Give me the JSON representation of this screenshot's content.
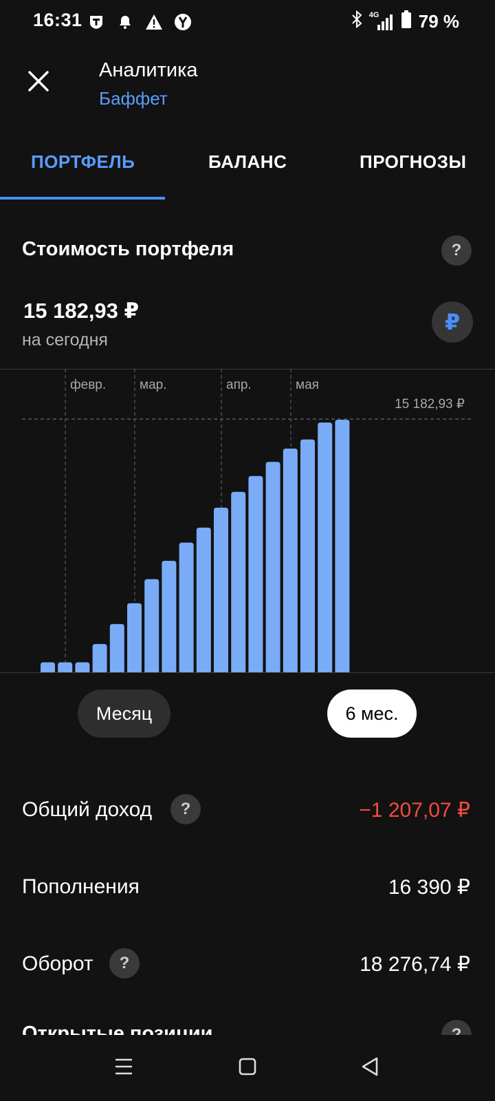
{
  "status": {
    "time": "16:31",
    "icons_left": [
      "t-app-icon",
      "bell-icon",
      "warning-icon",
      "yandex-icon"
    ],
    "network": "4G",
    "battery": "79 %"
  },
  "header": {
    "title": "Аналитика",
    "subtitle": "Баффет"
  },
  "tabs": [
    {
      "label": "ПОРТФЕЛЬ",
      "active": true,
      "color": "#5a9cff"
    },
    {
      "label": "БАЛАНС",
      "active": false
    },
    {
      "label": "ПРОГНОЗЫ",
      "active": false
    }
  ],
  "portfolio": {
    "section_title": "Стоимость портфеля",
    "help": "?",
    "value": "15 182,93 ₽",
    "value_caption": "на сегодня",
    "currency_symbol": "₽"
  },
  "chart_data": {
    "type": "bar",
    "month_labels": [
      "февр.",
      "мар.",
      "апр.",
      "мая"
    ],
    "max_label": "15 182,93 ₽",
    "ylim": [
      0,
      15182.93
    ],
    "values": [
      600,
      600,
      600,
      1700,
      2900,
      4150,
      5600,
      6700,
      7800,
      8700,
      9900,
      10850,
      11800,
      12650,
      13450,
      14000,
      15020,
      15182.93
    ],
    "bar_color": "#7aabf7"
  },
  "periods": [
    {
      "label": "Месяц",
      "selected": false
    },
    {
      "label": "6 мес.",
      "selected": true
    }
  ],
  "stats": [
    {
      "label": "Общий доход",
      "value": "−1 207,07 ₽",
      "help": true,
      "negative": true
    },
    {
      "label": "Пополнения",
      "value": "16 390 ₽",
      "help": false,
      "negative": false
    },
    {
      "label": "Оборот",
      "value": "18 276,74 ₽",
      "help": true,
      "negative": false
    }
  ],
  "next_section": "Открытые позиции"
}
